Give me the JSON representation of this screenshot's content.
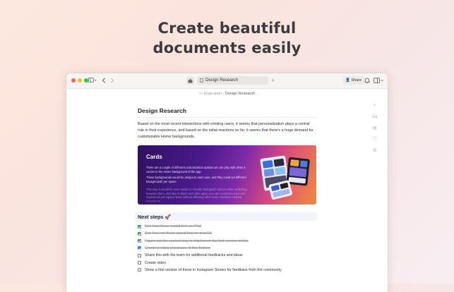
{
  "headline": [
    "Create beautiful",
    "documents easily"
  ],
  "window": {
    "url_title": "Design Research",
    "share_label": "Share",
    "icons": [
      "sidebar-icon",
      "back-icon",
      "forward-icon",
      "home-icon",
      "plus-icon",
      "bell-icon",
      "panel-icon"
    ]
  },
  "breadcrumb": {
    "parent": "Inspiration",
    "separator": "›",
    "current": "Design Research"
  },
  "doc": {
    "title": "Design Research",
    "paragraph": "Based on the most recent interactions with existing users, it seems that personalization plays a central role in their experience, and based on the initial reactions so far, it seems that there's a huge demand for customizable Home backgrounds.",
    "card": {
      "title": "Cards",
      "p1": "There are a couple of different customization options we can play with when it comes to the Home background of the app.",
      "p2": "These backgrounds would be unique to each user, and they could set different backgrounds per space.",
      "p3": "This way, it would be even easier to visually distinguish spaces when switching between them. Just like in Slack and other apps, you can customize your own experience per Space/Team without affecting other team members viewing experience."
    },
    "next_steps_title": "Next steps 🚀",
    "todos": [
      {
        "label": "See how these would feel on iPad",
        "done": true
      },
      {
        "label": "See how we these would feel on macOS",
        "done": true
      },
      {
        "label": "Figure out the easiest way to implement the first version of this",
        "done": true
      },
      {
        "label": "Create a video showcase of this feature",
        "done": true
      },
      {
        "label": "Share this with the team for additional feedbacks and ideas",
        "done": false
      },
      {
        "label": "Create video",
        "done": false
      },
      {
        "label": "Show a first version of these in Instagram Stories for feedback from the community",
        "done": false
      }
    ]
  },
  "colors": {
    "accent": "#3a82f7",
    "card_start": "#2e1160",
    "card_end": "#f28a3b"
  }
}
